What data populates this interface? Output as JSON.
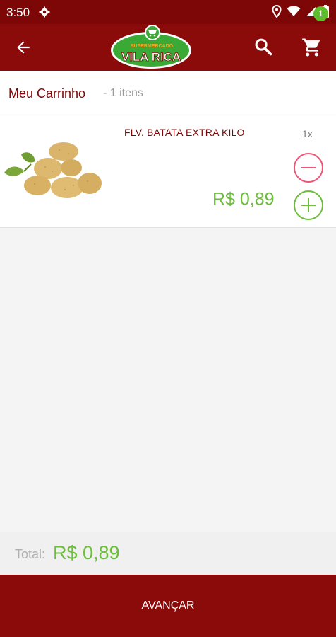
{
  "status_bar": {
    "time": "3:50"
  },
  "app_bar": {
    "logo": {
      "top_text": "SUPERMERCADO",
      "name": "VILA RICA"
    },
    "cart_badge": "1",
    "icons": {
      "back": "arrow-back-icon",
      "search": "search-icon",
      "cart": "cart-icon"
    }
  },
  "cart": {
    "title": "Meu Carrinho",
    "count": "- 1 itens"
  },
  "items": [
    {
      "name": "FLV. BATATA EXTRA KILO",
      "quantity": "1x",
      "price": "R$ 0,89"
    }
  ],
  "totals": {
    "label": "Total:",
    "value": "R$ 0,89"
  },
  "footer": {
    "advance_label": "AVANÇAR"
  },
  "colors": {
    "brand_dark_red": "#8b0b0b",
    "accent_green": "#6cbd3b",
    "minus_pink": "#ef5477"
  }
}
